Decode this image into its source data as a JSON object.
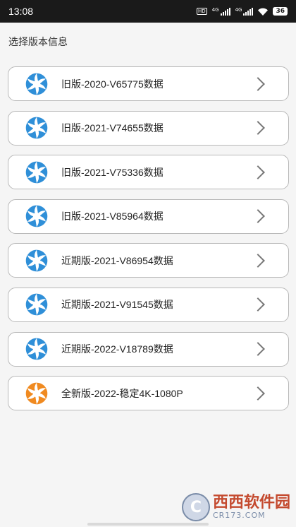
{
  "status_bar": {
    "time": "13:08",
    "hd_label": "HD",
    "sim1_label": "4G",
    "sim2_label": "4G",
    "battery": "36"
  },
  "header": {
    "title": "选择版本信息"
  },
  "versions": [
    {
      "label": "旧版-2020-V65775数据",
      "icon": "blue-swirl-icon"
    },
    {
      "label": "旧版-2021-V74655数据",
      "icon": "blue-swirl-icon"
    },
    {
      "label": "旧版-2021-V75336数据",
      "icon": "blue-swirl-icon"
    },
    {
      "label": "旧版-2021-V85964数据",
      "icon": "blue-swirl-icon"
    },
    {
      "label": "近期版-2021-V86954数据",
      "icon": "blue-swirl-icon"
    },
    {
      "label": "近期版-2021-V91545数据",
      "icon": "blue-swirl-icon"
    },
    {
      "label": "近期版-2022-V18789数据",
      "icon": "blue-swirl-icon"
    },
    {
      "label": "全新版-2022-稳定4K-1080P",
      "icon": "orange-swirl-icon"
    }
  ],
  "colors": {
    "swirl_blue": "#2f8fd8",
    "swirl_orange": "#f08a20"
  },
  "watermark": {
    "main": "西西软件园",
    "sub": "CR173.COM"
  }
}
